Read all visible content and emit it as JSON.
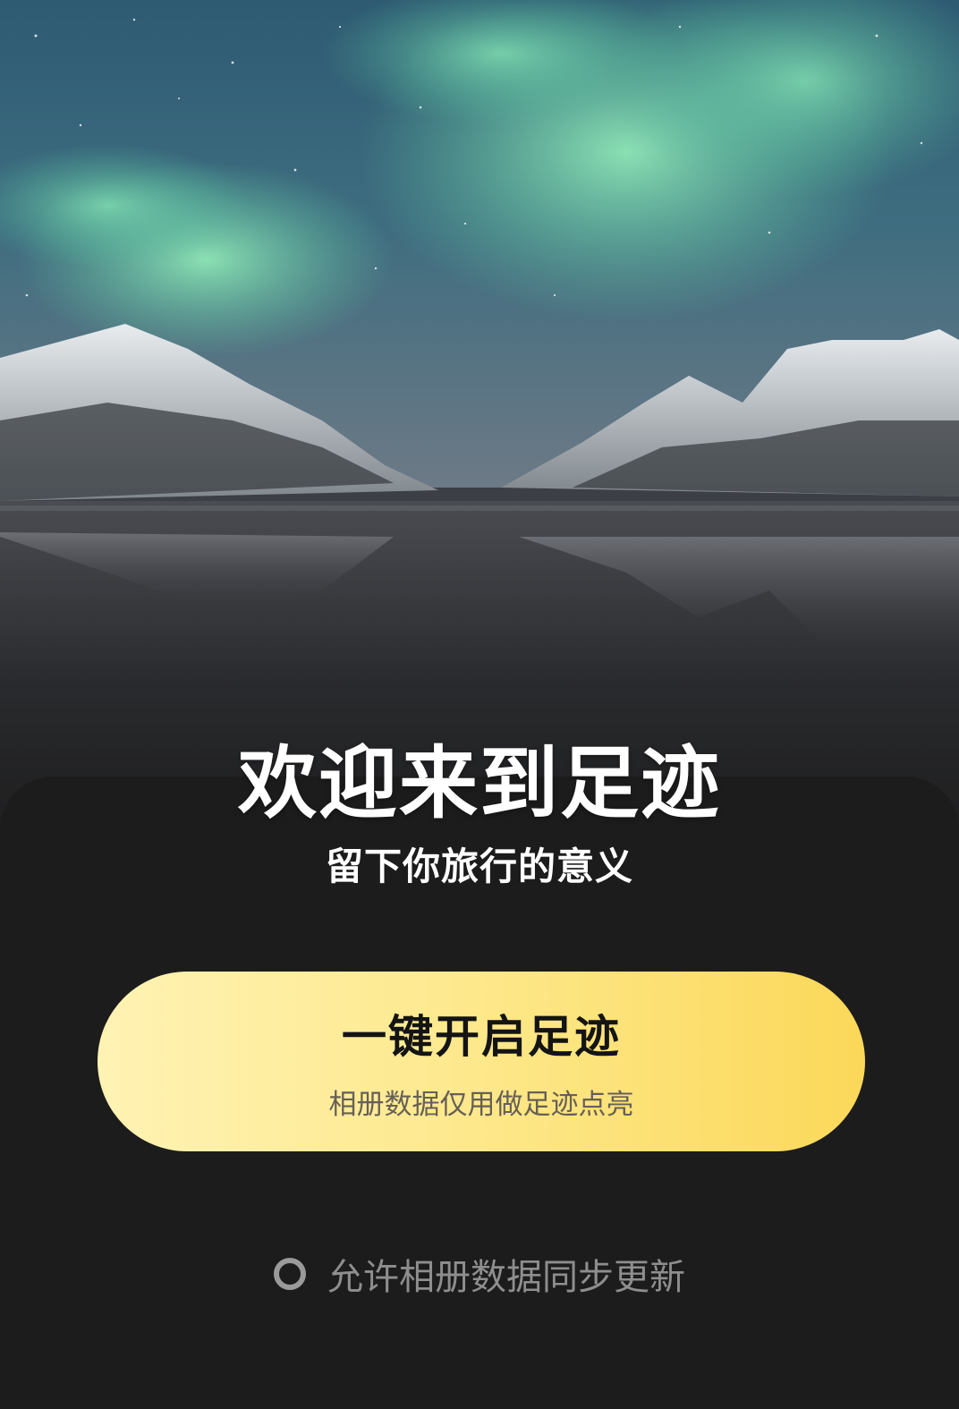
{
  "hero": {
    "image": "aurora-mountain-lake-photo"
  },
  "welcome": {
    "title": "欢迎来到足迹",
    "subtitle": "留下你旅行的意义"
  },
  "cta": {
    "title": "一键开启足迹",
    "subtitle": "相册数据仅用做足迹点亮"
  },
  "consent": {
    "label": "允许相册数据同步更新",
    "checked": false
  },
  "colors": {
    "background": "#1c1c1c",
    "button_gradient_start": "#fff3b4",
    "button_gradient_end": "#fbd859"
  }
}
